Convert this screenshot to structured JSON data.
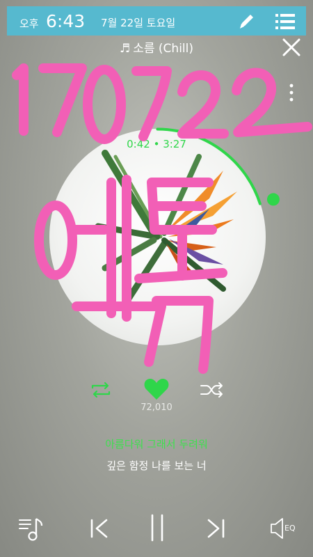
{
  "status_bar": {
    "ampm": "오후",
    "time": "6:43",
    "date": "7월 22일 토요일",
    "pencil_icon": "pencil-icon",
    "list_icon": "list-menu-icon",
    "background_color": "#56b9cf"
  },
  "header": {
    "genre_note_icon": "music-note-icon",
    "genre": "소름 (Chill)",
    "close_icon": "close-icon",
    "more_icon": "more-vertical-icon"
  },
  "player": {
    "elapsed": "0:42",
    "separator": "•",
    "duration": "3:27",
    "progress_fraction": 0.2,
    "accent_color": "#2fd64a"
  },
  "actions": {
    "repeat_icon": "repeat-icon",
    "like_icon": "heart-icon",
    "shuffle_icon": "shuffle-icon",
    "like_count": "72,010"
  },
  "lyrics": {
    "current": "아름다워 그래서 두려워",
    "next": "깊은 함정 나를 보는 너"
  },
  "transport": {
    "playlist_icon": "playlist-icon",
    "prev_icon": "previous-icon",
    "pause_icon": "pause-icon",
    "next_icon": "next-icon",
    "eq_icon": "equalizer-speaker-icon",
    "eq_label": "EQ"
  },
  "handwriting": {
    "line1": "170722",
    "line2": "엑톡",
    "color": "#f25fb6"
  }
}
